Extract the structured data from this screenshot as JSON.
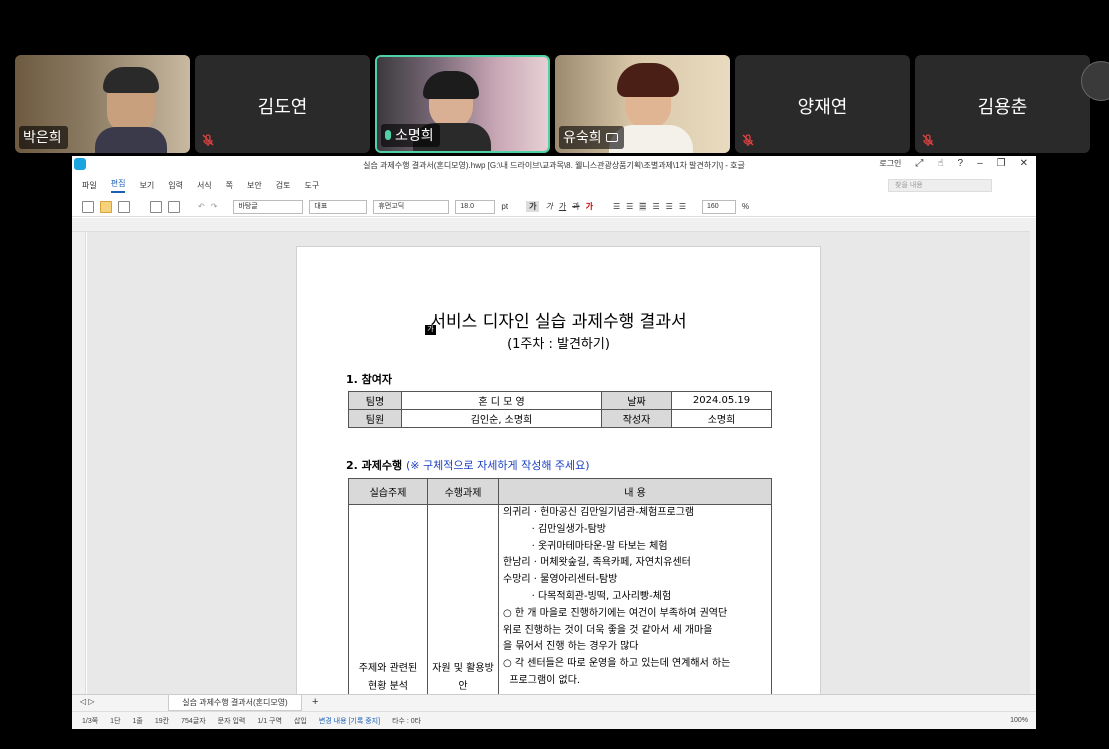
{
  "participants": [
    {
      "name": "박은희",
      "video": true,
      "active": false,
      "muted": false
    },
    {
      "name": "김도연",
      "video": false,
      "active": false,
      "muted": true
    },
    {
      "name": "소명희",
      "video": true,
      "active": true,
      "muted": false
    },
    {
      "name": "유숙희",
      "video": true,
      "active": false,
      "muted": false
    },
    {
      "name": "양재연",
      "video": false,
      "active": false,
      "muted": true
    },
    {
      "name": "김용춘",
      "video": false,
      "active": false,
      "muted": true
    }
  ],
  "window": {
    "title": "실습 과제수행 결과서(혼디모영).hwp [G:\\내 드라이브\\교과목\\8. 웰니스관광상품기획\\조별과제\\1차 발견하기\\] - 호글",
    "login": "로그인",
    "help": "?",
    "search_placeholder": "찾을 내용"
  },
  "menu": [
    "파일",
    "편집",
    "보기",
    "입력",
    "서식",
    "쪽",
    "보안",
    "검토",
    "도구"
  ],
  "toolbar": {
    "style": "바탕글",
    "para": "대표",
    "font": "휴먼고딕",
    "size": "18.0",
    "size_unit": "pt",
    "zoom": "160",
    "zoom_unit": "%",
    "b": "가",
    "i": "가",
    "u": "가",
    "s": "과"
  },
  "doc": {
    "title": "서비스 디자인 실습 과제수행 결과서",
    "subtitle": "(1주차 : 발견하기)",
    "caret_label": "가",
    "sec1": "1. 참여자",
    "sec2": "2. 과제수행",
    "sec2_note": "(※ 구체적으로 자세하게 작성해 주세요)",
    "t1": {
      "team_label": "팀명",
      "team": "혼 디 모 영",
      "date_label": "날짜",
      "date": "2024.05.19",
      "members_label": "팀원",
      "members": "김인순, 소명희",
      "writer_label": "작성자",
      "writer": "소명희"
    },
    "t2": {
      "h1": "실습주제",
      "h2": "수행과제",
      "h3": "내 용",
      "c1": "주제와 관련된 현황 분석",
      "c2": "자원 및 활용방안",
      "lines": [
        "의귀리 · 헌마공신 김만일기념관-체험프로그램",
        "         · 김만일생가-탐방",
        "         · 옷귀마테마타운-말 타보는 체험",
        "한남리 · 머체왓숲길, 족욕카페, 자연치유센터",
        "수망리 · 물영아리센터-탐방",
        "         · 다목적회관-빙떡, 고사리빵-체험",
        "○ 한 개 마을로 진행하기에는 여건이 부족하여 권역단",
        "위로 진행하는 것이 더욱 좋을 것 같아서 세 개마을",
        "을 묶어서 진행 하는 경우가 많다",
        "○ 각 센터들은 따로 운영을 하고 있는데 연계해서 하는",
        "  프로그램이 없다."
      ]
    }
  },
  "tab": "실습 과제수행 결과서(혼디모영)",
  "tab_add": "+",
  "status": {
    "page": "1/3쪽",
    "section": "1단",
    "line": "1줄",
    "col": "19칸",
    "chars": "754글자",
    "mode": "문자 입력",
    "area": "1/1 구역",
    "insert": "삽입",
    "track": "변경 내용 [기록 중지]",
    "strokes": "타수 : 0타",
    "zoom": "100%"
  }
}
